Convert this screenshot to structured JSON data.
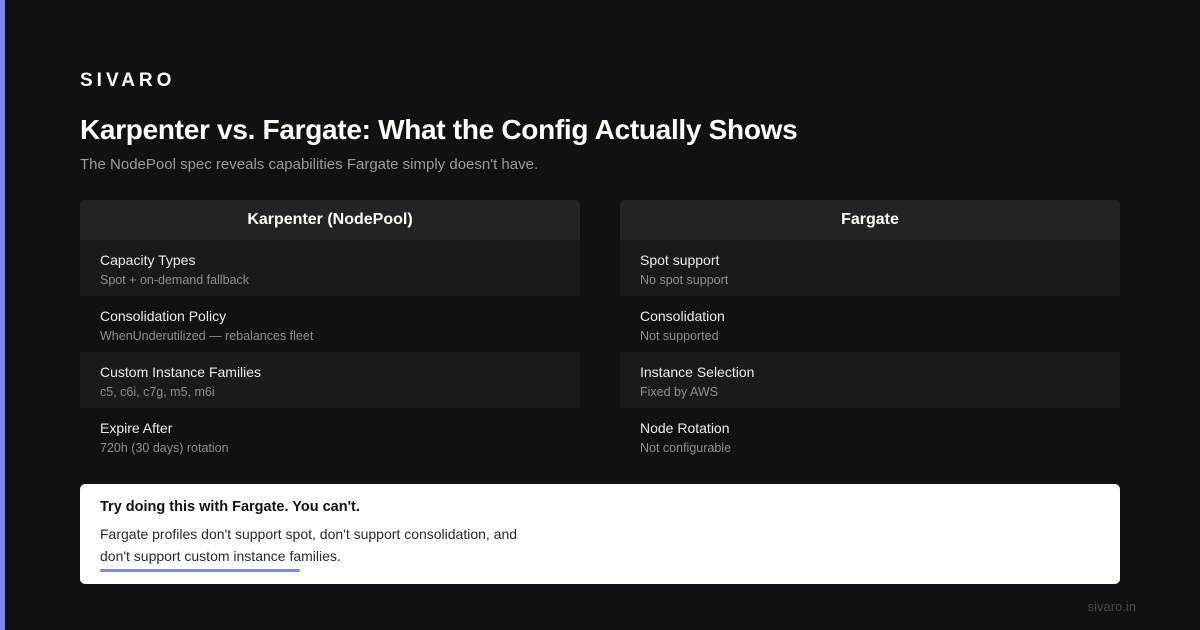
{
  "brand": "SIVARO",
  "title": "Karpenter vs. Fargate: What the Config Actually Shows",
  "subtitle": "The NodePool spec reveals capabilities Fargate simply doesn't have.",
  "accent_color": "#7c87f0",
  "left": {
    "header": "Karpenter (NodePool)",
    "rows": [
      {
        "label": "Capacity Types",
        "value": "Spot + on-demand fallback"
      },
      {
        "label": "Consolidation Policy",
        "value": "WhenUnderutilized — rebalances fleet"
      },
      {
        "label": "Custom Instance Families",
        "value": "c5, c6i, c7g, m5, m6i"
      },
      {
        "label": "Expire After",
        "value": "720h (30 days) rotation"
      }
    ]
  },
  "right": {
    "header": "Fargate",
    "rows": [
      {
        "label": "Spot support",
        "value": "No spot support"
      },
      {
        "label": "Consolidation",
        "value": "Not supported"
      },
      {
        "label": "Instance Selection",
        "value": "Fixed by AWS"
      },
      {
        "label": "Node Rotation",
        "value": "Not configurable"
      }
    ]
  },
  "callout": {
    "title": "Try doing this with Fargate. You can't.",
    "body": "Fargate profiles don't support spot, don't support consolidation, and don't support custom instance families."
  },
  "footer": "sivaro.in"
}
